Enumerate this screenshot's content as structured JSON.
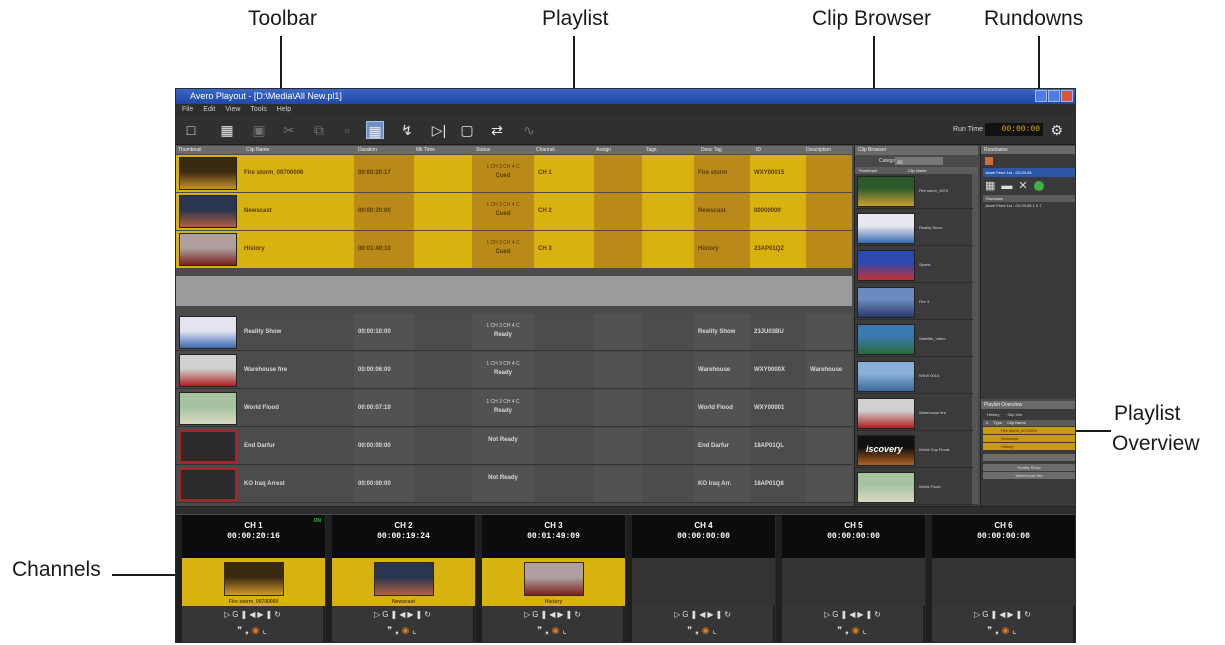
{
  "callouts": {
    "toolbar": "Toolbar",
    "playlist": "Playlist",
    "clip_browser": "Clip Browser",
    "rundowns": "Rundowns",
    "playlist_overview_1": "Playlist",
    "playlist_overview_2": "Overview",
    "channels": "Channels"
  },
  "window": {
    "title": "Avero Playout - [D:\\Media\\All New.pl1]",
    "menu": [
      "File",
      "Edit",
      "View",
      "Tools",
      "Help"
    ]
  },
  "toolbar": {
    "run_time_label": "Run Time",
    "run_time_value": "00:00:00"
  },
  "playlist": {
    "columns": [
      "Thumbnail",
      "Clip Name",
      "Duration",
      "Mk Time",
      "Status",
      "Channel",
      "Assign",
      "Tags",
      "Desc Tag",
      "ID",
      "Description"
    ],
    "rows": [
      {
        "name": "Fire storm_00700006",
        "duration": "00:00:20:17",
        "status_top": "1 CH 3 CH 4 C",
        "status": "Cued",
        "channel": "CH 1",
        "desc": "Fire storm",
        "id": "WXY00015",
        "state": "cued",
        "thumb": [
          "#3b2a12",
          "#c8902a"
        ]
      },
      {
        "name": "Newscast",
        "duration": "00:00:20:00",
        "status_top": "1 CH 3 CH 4 C",
        "status": "Cued",
        "channel": "CH 2",
        "desc": "Newscast",
        "id": "00000000",
        "state": "cued",
        "thumb": [
          "#2a3550",
          "#b26040"
        ]
      },
      {
        "name": "History",
        "duration": "00:01:49:10",
        "status_top": "1 CH 3 CH 4 C",
        "status": "Cued",
        "channel": "CH 3",
        "desc": "History",
        "id": "23AP01QZ",
        "state": "cued",
        "thumb": [
          "#b0a0a0",
          "#7a2020"
        ]
      },
      {
        "name": "Reality Show",
        "duration": "00:00:10:00",
        "status_top": "1 CH 3 CH 4 C",
        "status": "Ready",
        "channel": "",
        "desc": "Reality Show",
        "id": "23JU03BU",
        "state": "ready",
        "thumb": [
          "#e4e4f0",
          "#3a6ab0"
        ]
      },
      {
        "name": "Warehouse fire",
        "duration": "00:00:06:00",
        "status_top": "1 CH 3 CH 4 C",
        "status": "Ready",
        "channel": "",
        "desc": "Warehouse",
        "id": "WXY0000X",
        "extra": "Warehouse",
        "state": "ready",
        "thumb": [
          "#d0d0d0",
          "#b02020"
        ]
      },
      {
        "name": "World Flood",
        "duration": "00:00:07:19",
        "status_top": "1 CH 3 CH 4 C",
        "status": "Ready",
        "channel": "",
        "desc": "World Flood",
        "id": "WXY00001",
        "state": "ready",
        "thumb": [
          "#a6c2a0",
          "#d8d8c0"
        ]
      },
      {
        "name": "End Darfur",
        "duration": "00:00:00:00",
        "status_top": "",
        "status": "Not Ready",
        "channel": "",
        "desc": "End Darfur",
        "id": "18AP01QL",
        "state": "notready",
        "thumb": []
      },
      {
        "name": "KO Iraq Arrest",
        "duration": "00:00:00:00",
        "status_top": "",
        "status": "Not Ready",
        "channel": "",
        "desc": "KO Iraq Arr.",
        "id": "18AP01Q8",
        "state": "notready",
        "thumb": []
      }
    ]
  },
  "clip_browser": {
    "title": "Clip Browser",
    "category_label": "Category",
    "category_value": "All",
    "columns": [
      "Thumbnail",
      "Clip Name"
    ],
    "items": [
      {
        "name": "Fire storm_0070",
        "colors": [
          "#2d5a2d",
          "#c8a030"
        ]
      },
      {
        "name": "Reality Show",
        "colors": [
          "#e8e8f0",
          "#3a6ab0"
        ]
      },
      {
        "name": "Sports",
        "colors": [
          "#2a4ab0",
          "#c83030"
        ]
      },
      {
        "name": "Fire 3",
        "colors": [
          "#6a8ac0",
          "#2a3a6a"
        ]
      },
      {
        "name": "Satellite_Video",
        "colors": [
          "#3a7ab0",
          "#2a6a3a"
        ]
      },
      {
        "name": "WXW 0014",
        "colors": [
          "#8ab0d8",
          "#3a6a9a"
        ]
      },
      {
        "name": "Warehouse fire",
        "colors": [
          "#d0d0d0",
          "#b02020"
        ]
      },
      {
        "name": "World Cup Finals",
        "colors": [
          "#101010",
          "#b06020"
        ]
      },
      {
        "name": "World Flood",
        "colors": [
          "#a6c2a0",
          "#d8d8c0"
        ]
      }
    ],
    "item_overlay_text": "iscovery"
  },
  "rundowns": {
    "title": "Rundowns",
    "selected": "Jewel Feed 1st - 03-09-08",
    "column": "Rundown",
    "item": "Jewel Feed 1st - 03-09-08  1 0 7"
  },
  "overview": {
    "title": "Playlist Overview",
    "tabs": [
      "History",
      "Clip Info"
    ],
    "columns": [
      "#",
      "Type",
      "Clip Name"
    ],
    "rows": [
      "Fire storm_0070000",
      "Newscast",
      "History"
    ],
    "grey_rows": [
      "Reality Show",
      "Warehouse fire"
    ]
  },
  "channels": [
    {
      "name": "CH 1",
      "time": "00:00:20:16",
      "badge": "ON",
      "clip": "Fire storm_00700000",
      "colors": [
        "#3b2a12",
        "#d09a2a"
      ]
    },
    {
      "name": "CH 2",
      "time": "00:00:19:24",
      "badge": "",
      "clip": "Newscast",
      "colors": [
        "#2a3550",
        "#b26040"
      ]
    },
    {
      "name": "CH 3",
      "time": "00:01:49:09",
      "badge": "",
      "clip": "History",
      "colors": [
        "#b0a0a0",
        "#7a2020"
      ]
    },
    {
      "name": "CH 4",
      "time": "00:00:00:00",
      "badge": "",
      "clip": "",
      "colors": []
    },
    {
      "name": "CH 5",
      "time": "00:00:00:00",
      "badge": "",
      "clip": "",
      "colors": []
    },
    {
      "name": "CH 6",
      "time": "00:00:00:00",
      "badge": "",
      "clip": "",
      "colors": []
    }
  ],
  "icons": [
    "new-doc",
    "open",
    "save",
    "cut",
    "copy",
    "paste",
    "grid",
    "branch",
    "play-next",
    "stop",
    "transfer",
    "disabled"
  ],
  "colors": {
    "cued": "#d8b20f",
    "cued_alt": "#b98a1a",
    "ready": "#4c4c4c",
    "title_blue": "#1f47a6",
    "runtime": "#e3b400"
  }
}
